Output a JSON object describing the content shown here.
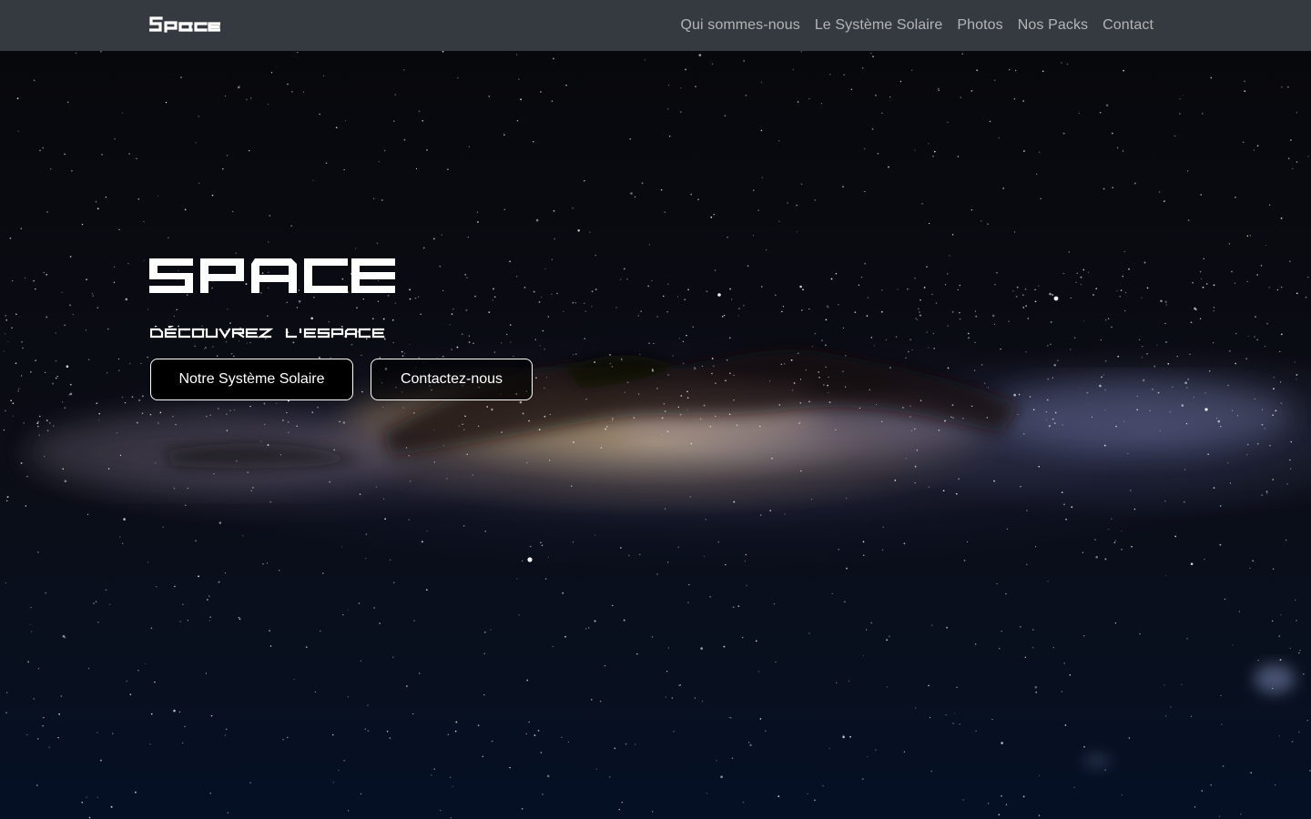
{
  "navbar": {
    "brand": "Space",
    "links": [
      {
        "label": "Qui sommes-nous"
      },
      {
        "label": "Le Système Solaire"
      },
      {
        "label": "Photos"
      },
      {
        "label": "Nos Packs"
      },
      {
        "label": "Contact"
      }
    ]
  },
  "hero": {
    "title": "SPACE",
    "subtitle": "DÉCOUVREZ L'ESPACE",
    "buttons": {
      "solar_label": "Notre Système Solaire",
      "contact_label": "Contactez-nous"
    }
  },
  "colors": {
    "navbar_bg": "#343a40",
    "nav_link": "rgba(255,255,255,0.62)",
    "button_border": "#ffffff",
    "sky_top": "#07080c",
    "sky_bottom": "#061025"
  },
  "background_image": "milky-way-starfield"
}
